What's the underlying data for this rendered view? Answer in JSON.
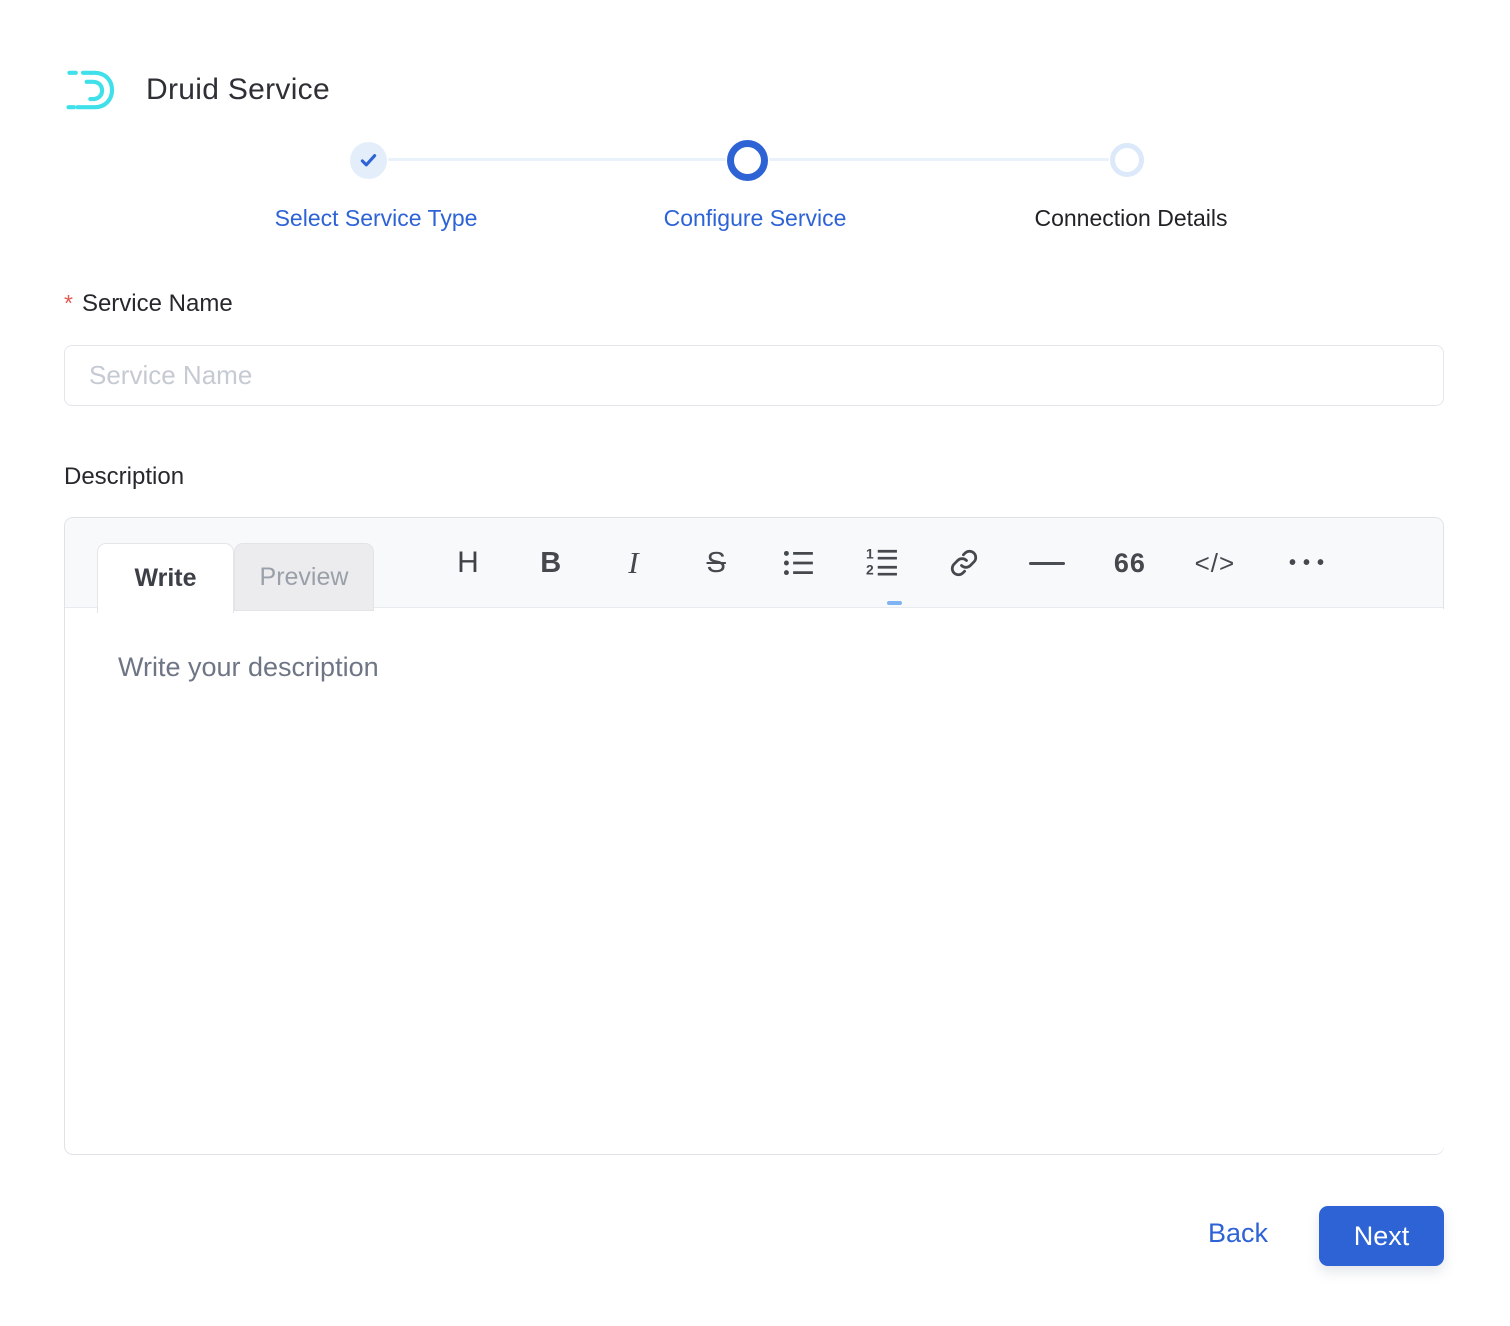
{
  "header": {
    "title": "Druid Service"
  },
  "stepper": {
    "steps": [
      {
        "label": "Select Service Type",
        "state": "completed"
      },
      {
        "label": "Configure Service",
        "state": "active"
      },
      {
        "label": "Connection Details",
        "state": "upcoming"
      }
    ]
  },
  "form": {
    "service_name": {
      "required_marker": "*",
      "label": "Service Name",
      "placeholder": "Service Name",
      "value": ""
    },
    "description": {
      "label": "Description",
      "tabs": [
        {
          "label": "Write",
          "active": true
        },
        {
          "label": "Preview",
          "active": false
        }
      ],
      "toolbar": [
        {
          "name": "heading",
          "glyph": "H"
        },
        {
          "name": "bold",
          "glyph": "B"
        },
        {
          "name": "italic",
          "glyph": "I"
        },
        {
          "name": "strikethrough",
          "glyph": "S"
        },
        {
          "name": "unordered-list"
        },
        {
          "name": "ordered-list"
        },
        {
          "name": "link"
        },
        {
          "name": "horizontal-rule"
        },
        {
          "name": "quote",
          "glyph": "66"
        },
        {
          "name": "code",
          "glyph": "</>"
        },
        {
          "name": "more",
          "glyph": "•••"
        }
      ],
      "placeholder": "Write your description",
      "value": ""
    }
  },
  "footer": {
    "back_label": "Back",
    "next_label": "Next"
  },
  "colors": {
    "accent_blue": "#2E63D6",
    "logo_cyan": "#40E0EA",
    "required_red": "#E25950",
    "step_completed_bg": "#E4EEFB",
    "step_upcoming_ring": "#DCE9FA",
    "toolbar_bg": "#F8F9FB"
  }
}
